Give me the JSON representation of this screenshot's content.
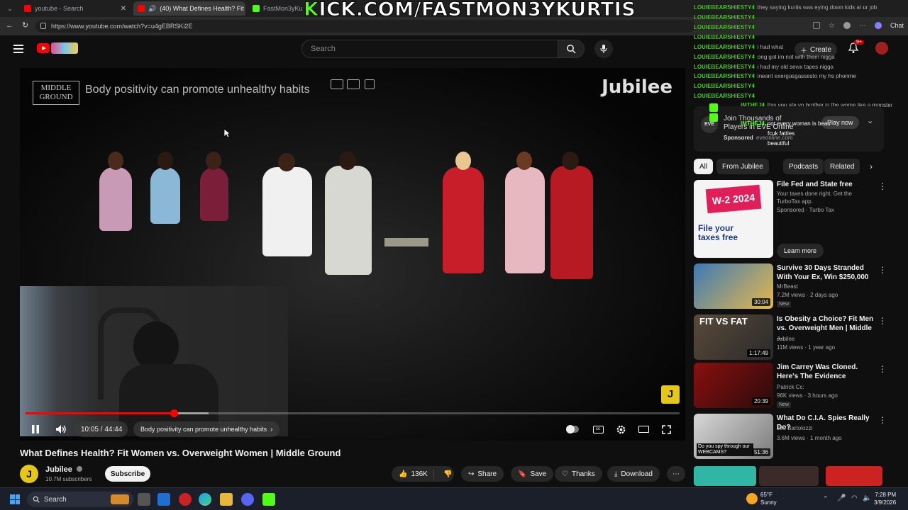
{
  "browser": {
    "tabs": [
      {
        "label": "youtube - Search",
        "active": false
      },
      {
        "label": "(40) What Defines Health? Fit",
        "active": true
      },
      {
        "label": "FastMon3yKurtis",
        "active": false
      }
    ],
    "url": "https://www.youtube.com/watch?v=u4gEBRSKi2E",
    "right_label": "Chat"
  },
  "overlay": {
    "kick_k": "K",
    "kick_rest": "ICK.COM/FASTMON3YKURTIS"
  },
  "youtube": {
    "search_placeholder": "Search",
    "create_label": "Create",
    "notifications_badge": "9+"
  },
  "player": {
    "overlay_title": "Body positivity can promote unhealthy habits",
    "logo_text": "MIDDLE GROUND",
    "brand_logo": "Jubilee",
    "current_time": "10:05 / 44:44",
    "chapter": "Body positivity can promote unhealthy habits",
    "progress_played": 0.227,
    "progress_buffered": 0.28,
    "watermark": "J"
  },
  "video": {
    "title": "What Defines Health? Fit Women vs. Overweight Women | Middle Ground",
    "channel": "Jubilee",
    "subscribers": "10.7M subscribers",
    "subscribe_label": "Subscribe",
    "likes": "136K",
    "share_label": "Share",
    "save_label": "Save",
    "thanks_label": "Thanks",
    "download_label": "Download"
  },
  "chat": [
    {
      "user": "LOUIEBEARSHIESTY4",
      "msg": "they saying kurtis was eying down kids at ur job"
    },
    {
      "user": "LOUIEBEARSHIESTY4",
      "msg": ""
    },
    {
      "user": "LOUIEBEARSHIESTY4",
      "msg": ""
    },
    {
      "user": "LOUIEBEARSHIESTY4",
      "msg": ""
    },
    {
      "user": "LOUIEBEARSHIESTY4",
      "msg": "i had what"
    },
    {
      "user": "LOUIEBEARSHIESTY4",
      "msg": "ong got im not with them nigga"
    },
    {
      "user": "LOUIEBEARSHIESTY4",
      "msg": "i had my old sewx tapes nigga"
    },
    {
      "user": "LOUIEBEARSHIESTY4",
      "msg": "ineant exergasgassesto my hs phonme"
    },
    {
      "user": "LOUIEBEARSHIESTY4",
      "msg": ""
    },
    {
      "user": "LOUIEBEARSHIESTY4",
      "msg": ""
    },
    {
      "user": "IMTHEJ4",
      "msg": "Itss you ate yo brother in the wome like a monster"
    },
    {
      "user": "IMTHEJ4",
      "msg": "not every woman is beau"
    },
    {
      "user": "",
      "msg": "fcuk fatties"
    },
    {
      "user": "",
      "msg": "beautiful"
    }
  ],
  "ad_card": {
    "title": "Join Thousands of Players in EVE Online",
    "sponsored": "Sponsored",
    "domain": "eveonline.com",
    "cta": "Play now"
  },
  "chips": [
    "All",
    "From Jubilee",
    "Podcasts",
    "Related"
  ],
  "recommendations": [
    {
      "title": "File Fed and State free",
      "channel": "Your taxes done right. Get the TurboTax app.",
      "meta": "Sponsored · Turbo Tax",
      "duration": "",
      "badge": "",
      "cta": "Learn more",
      "thumb_text": "W-2 2024",
      "thumb_sub": "File your taxes free"
    },
    {
      "title": "Survive 30 Days Stranded With Your Ex, Win $250,000",
      "channel": "MrBeast",
      "meta": "7.2M views · 2 days ago",
      "duration": "30:04",
      "badge": "New"
    },
    {
      "title": "Is Obesity a Choice? Fit Men vs. Overweight Men | Middle ...",
      "channel": "Jubilee",
      "meta": "11M views · 1 year ago",
      "duration": "1:17:49",
      "badge": "",
      "thumb_text": "FIT VS FAT"
    },
    {
      "title": "Jim Carrey Was Cloned. Here's The Evidence",
      "channel": "Patrick Cc:",
      "meta": "96K views · 3 hours ago",
      "duration": "20:39",
      "badge": "New"
    },
    {
      "title": "What Do C.I.A. Spies Really Do?",
      "channel": "Joe Bartolozzi",
      "meta": "3.6M views · 1 month ago",
      "duration": "51:36",
      "badge": "",
      "thumb_text": "Do you spy through our WEBCAMS?"
    }
  ],
  "taskbar": {
    "search_label": "Search",
    "weather_temp": "65°F",
    "weather_desc": "Sunny",
    "time": "7:28 PM",
    "date": "3/9/2026"
  }
}
